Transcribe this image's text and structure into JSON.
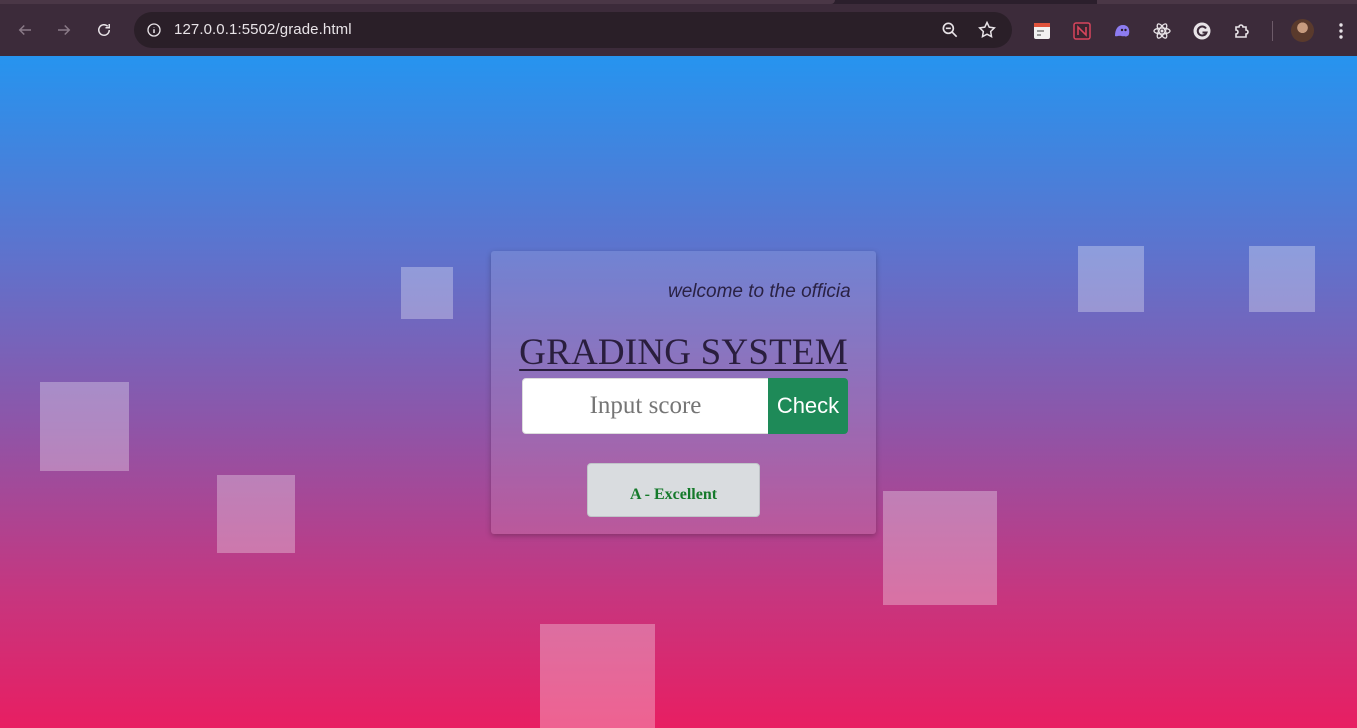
{
  "browser": {
    "url": "127.0.0.1:5502/grade.html"
  },
  "page": {
    "marquee_text": "welcome to the officia",
    "title": "GRADING SYSTEM",
    "score_placeholder": "Input score",
    "check_label": "Check",
    "result_text": "A - Excellent"
  },
  "colors": {
    "gradient_top": "#2694ef",
    "gradient_bottom": "#e81e62",
    "check_button": "#1e8a58",
    "result_text": "#157a2b"
  }
}
